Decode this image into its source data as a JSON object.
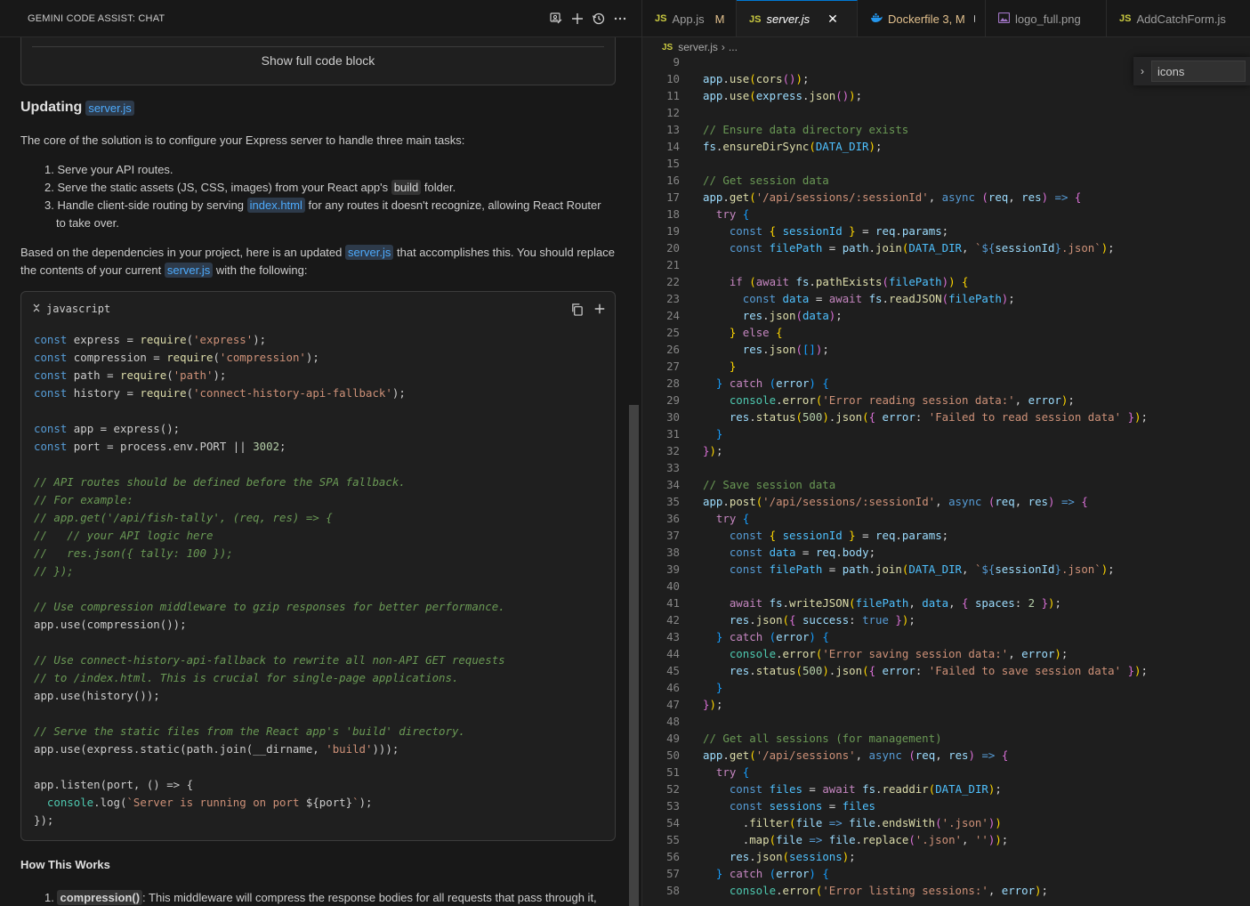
{
  "chat": {
    "title": "GEMINI CODE ASSIST: CHAT",
    "show_full_code": "Show full code block",
    "heading": "Updating",
    "heading_file": "server.js",
    "intro": "The core of the solution is to configure your Express server to handle three main tasks:",
    "tasks": [
      {
        "num": "1.",
        "text": "Serve your API routes."
      },
      {
        "num": "2.",
        "pre": "Serve the static assets (JS, CSS, images) from your React app's ",
        "chip": "build",
        "post": " folder."
      },
      {
        "num": "3.",
        "pre": "Handle client-side routing by serving ",
        "chip": "index.html",
        "post": " for any routes it doesn't recognize, allowing React Router to take over."
      }
    ],
    "para2_a": "Based on the dependencies in your project, here is an updated ",
    "para2_chip": "server.js",
    "para2_b": " that accomplishes this. You should replace the contents of your current ",
    "para2_chip2": "server.js",
    "para2_c": " with the following:",
    "code_lang": "javascript",
    "how_heading": "How This Works",
    "how_item_num": "1.",
    "how_item_chip": "compression()",
    "how_item_text": ": This middleware will compress the response bodies for all requests that pass through it,"
  },
  "editor": {
    "tabs": [
      {
        "icon": "JS",
        "label": "App.js",
        "status": "M",
        "active": false
      },
      {
        "icon": "JS",
        "label": "server.js",
        "status": "",
        "active": true
      },
      {
        "icon": "docker",
        "label": "Dockerfile 3, M",
        "status": "dot",
        "active": false
      },
      {
        "icon": "image",
        "label": "logo_full.png",
        "status": "",
        "active": false
      },
      {
        "icon": "JS",
        "label": "AddCatchForm.js",
        "status": "",
        "active": false
      }
    ],
    "breadcrumb": [
      "server.js",
      "..."
    ],
    "find_value": "icons",
    "first_line_number": 9
  },
  "colors": {
    "accent": "#0078d4",
    "link": "#4daafc",
    "js_icon": "#cbcb41",
    "modified": "#e2c08d"
  }
}
